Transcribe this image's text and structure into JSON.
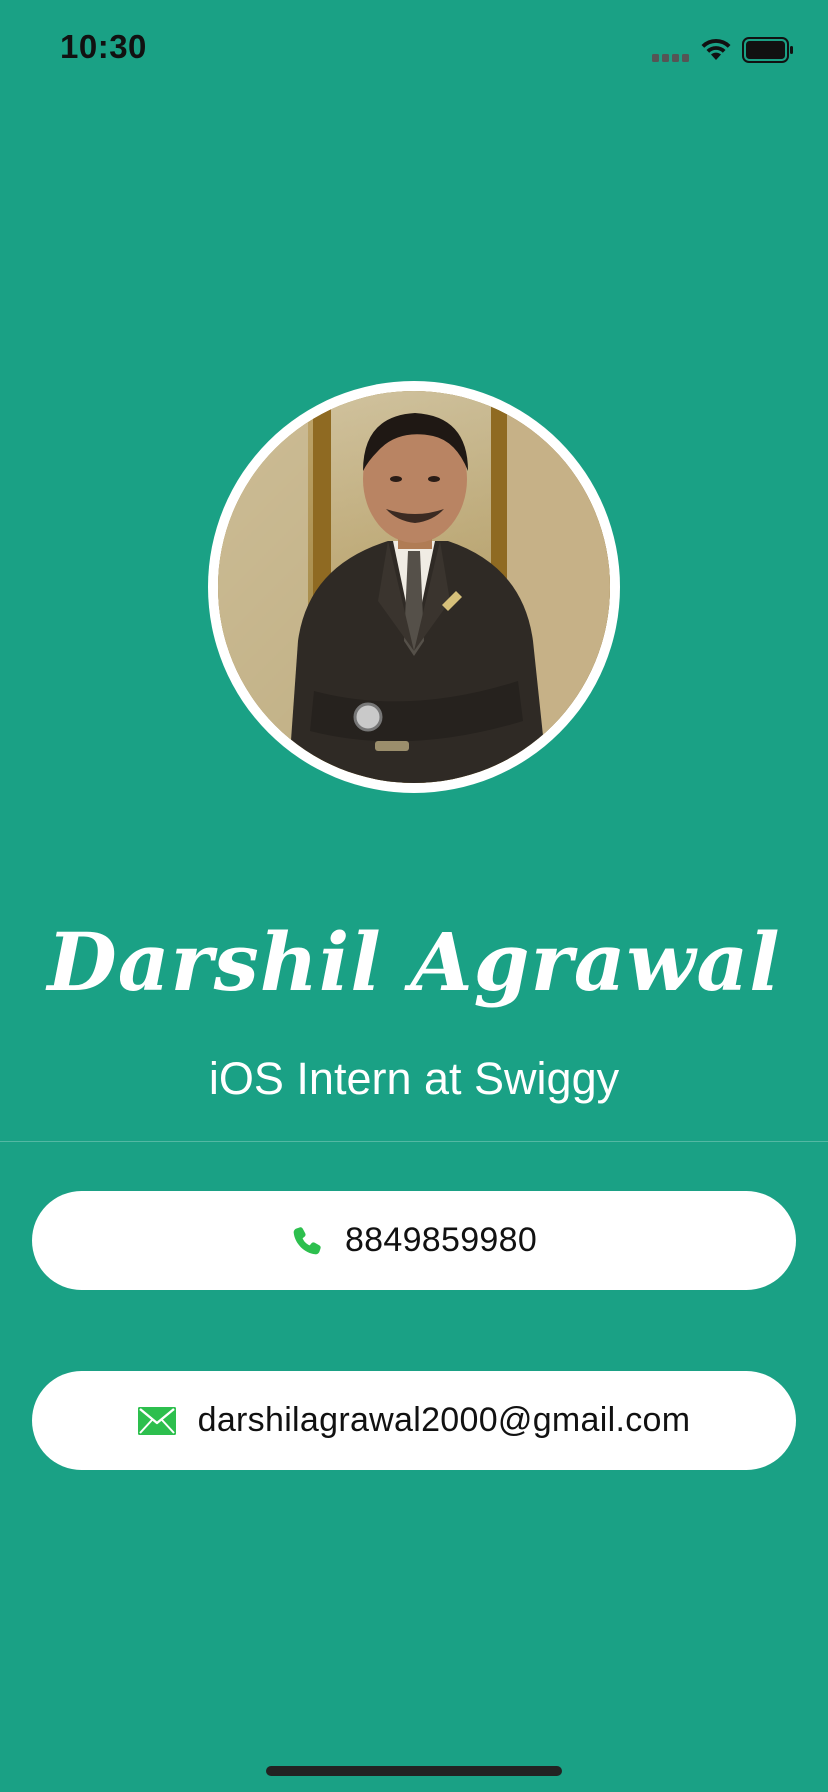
{
  "status_bar": {
    "time": "10:30",
    "icons": [
      "signal-icon",
      "wifi-icon",
      "battery-icon"
    ]
  },
  "profile": {
    "name": "Darshil Agrawal",
    "title": "iOS Intern at Swiggy",
    "avatar": "profile-photo"
  },
  "contacts": {
    "phone": {
      "icon": "phone-icon",
      "value": "8849859980"
    },
    "email": {
      "icon": "envelope-icon",
      "value": "darshilagrawal2000@gmail.com"
    }
  },
  "colors": {
    "background": "#1aa185",
    "card": "#ffffff",
    "icon_green": "#2dbf4e",
    "text_dark": "#111111"
  }
}
